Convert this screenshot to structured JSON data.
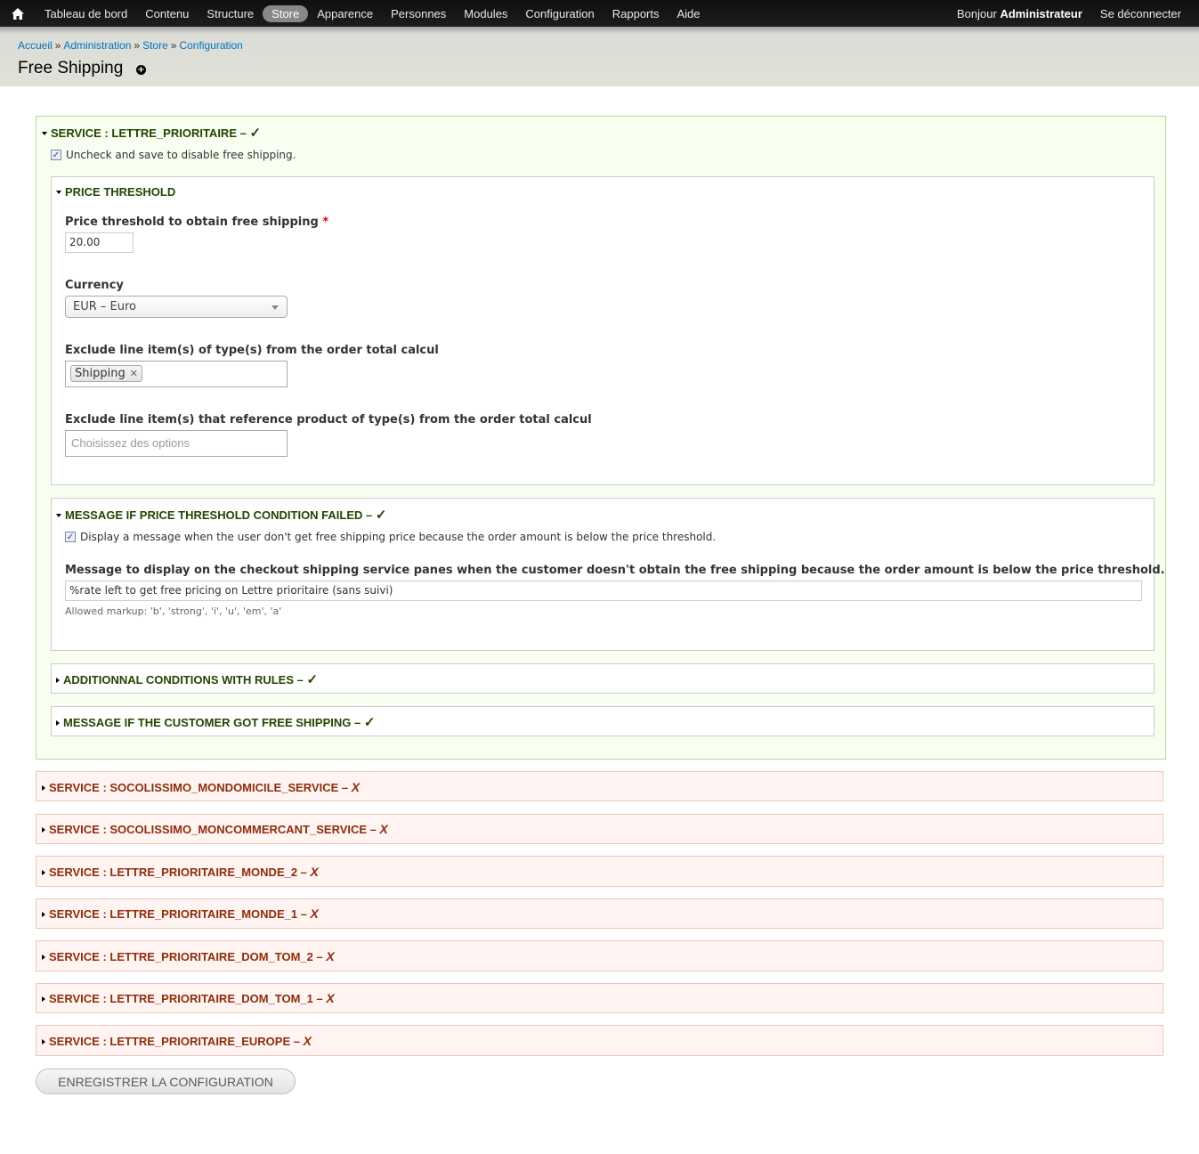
{
  "toolbar": {
    "home_icon": "home-icon",
    "menu": [
      {
        "label": "Tableau de bord"
      },
      {
        "label": "Contenu"
      },
      {
        "label": "Structure"
      },
      {
        "label": "Store"
      },
      {
        "label": "Apparence"
      },
      {
        "label": "Personnes"
      },
      {
        "label": "Modules"
      },
      {
        "label": "Configuration"
      },
      {
        "label": "Rapports"
      },
      {
        "label": "Aide"
      }
    ],
    "active_item": "Store",
    "greeting_prefix": "Bonjour",
    "greeting_user": "Administrateur",
    "logout": "Se déconnecter"
  },
  "breadcrumb": {
    "items": [
      "Accueil",
      "Administration",
      "Store",
      "Configuration"
    ],
    "separator": "»"
  },
  "page_title": "Free Shipping",
  "service_main": {
    "legend": "SERVICE : LETTRE_PRIORITAIRE – ",
    "status": "✓",
    "enable_label": "Uncheck and save to disable free shipping.",
    "price_threshold": {
      "legend": "PRICE THRESHOLD",
      "threshold_label": "Price threshold to obtain free shipping",
      "required_mark": "*",
      "threshold_value": "20.00",
      "currency_label": "Currency",
      "currency_value": "EUR – Euro",
      "exclude_types_label": "Exclude line item(s) of type(s) from the order total calcul",
      "exclude_types_tag": "Shipping",
      "exclude_tag_remove": "✕",
      "exclude_products_label": "Exclude line item(s) that reference product of type(s) from the order total calcul",
      "exclude_products_placeholder": "Choisissez des options"
    },
    "message_failed": {
      "legend": "MESSAGE IF PRICE THRESHOLD CONDITION FAILED – ",
      "status": "✓",
      "display_label": "Display a message when the user don't get free shipping price because the order amount is below the price threshold.",
      "message_label": "Message to display on the checkout shipping service panes when the customer doesn't obtain the free shipping because the order amount is below the price threshold.",
      "message_value": "%rate left to get free pricing on Lettre prioritaire (sans suivi)",
      "help": "Allowed markup: 'b', 'strong', 'i', 'u', 'em', 'a'"
    },
    "additional": {
      "legend": "ADDITIONNAL CONDITIONS WITH RULES – ",
      "status": "✓"
    },
    "message_got": {
      "legend": "MESSAGE IF THE CUSTOMER GOT FREE SHIPPING – ",
      "status": "✓"
    }
  },
  "other_services": [
    {
      "legend": "SERVICE : SOCOLISSIMO_MONDOMICILE_SERVICE – ",
      "status": "X"
    },
    {
      "legend": "SERVICE : SOCOLISSIMO_MONCOMMERCANT_SERVICE – ",
      "status": "X"
    },
    {
      "legend": "SERVICE : LETTRE_PRIORITAIRE_MONDE_2 – ",
      "status": "X"
    },
    {
      "legend": "SERVICE : LETTRE_PRIORITAIRE_MONDE_1 – ",
      "status": "X"
    },
    {
      "legend": "SERVICE : LETTRE_PRIORITAIRE_DOM_TOM_2 – ",
      "status": "X"
    },
    {
      "legend": "SERVICE : LETTRE_PRIORITAIRE_DOM_TOM_1 – ",
      "status": "X"
    },
    {
      "legend": "SERVICE : LETTRE_PRIORITAIRE_EUROPE – ",
      "status": "X"
    }
  ],
  "save_button": "Enregistrer la configuration",
  "colors": {
    "enabled_green": "#234600",
    "disabled_red": "#8c2e0b",
    "link_blue": "#0074bd",
    "required_red": "#ee0000"
  }
}
